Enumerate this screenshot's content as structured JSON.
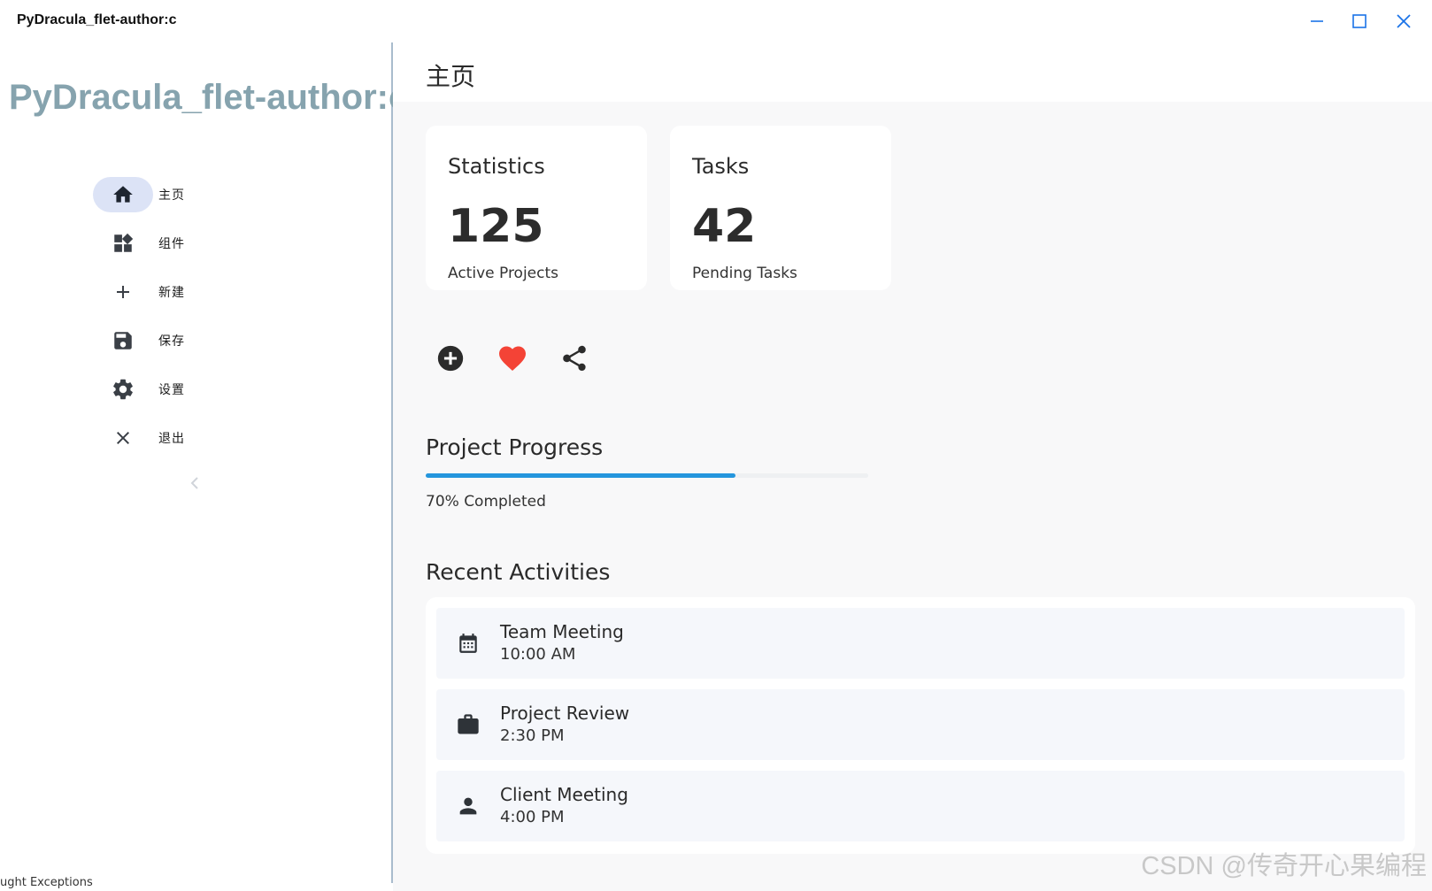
{
  "window": {
    "title": "PyDracula_flet-author:c"
  },
  "sidebar": {
    "brand": "PyDracula_flet-author:c",
    "items": [
      {
        "label": "主页",
        "icon": "home-icon",
        "active": true
      },
      {
        "label": "组件",
        "icon": "widgets-icon",
        "active": false
      },
      {
        "label": "新建",
        "icon": "add-icon",
        "active": false
      },
      {
        "label": "保存",
        "icon": "save-icon",
        "active": false
      },
      {
        "label": "设置",
        "icon": "settings-icon",
        "active": false
      },
      {
        "label": "退出",
        "icon": "close-icon",
        "active": false
      }
    ],
    "console_text": "ught Exceptions"
  },
  "main": {
    "page_title": "主页",
    "cards": [
      {
        "title": "Statistics",
        "value": "125",
        "subtitle": "Active Projects"
      },
      {
        "title": "Tasks",
        "value": "42",
        "subtitle": "Pending Tasks"
      }
    ],
    "actions": [
      {
        "icon": "add-circle-icon",
        "color": "#2b2b2b"
      },
      {
        "icon": "heart-icon",
        "color": "#f44336"
      },
      {
        "icon": "share-icon",
        "color": "#2b2b2b"
      }
    ],
    "progress": {
      "title": "Project Progress",
      "value": 0.7,
      "label": "70% Completed",
      "color": "#2496dd"
    },
    "activities": {
      "title": "Recent Activities",
      "items": [
        {
          "name": "Team Meeting",
          "time": "10:00 AM",
          "icon": "calendar-icon"
        },
        {
          "name": "Project Review",
          "time": "2:30 PM",
          "icon": "briefcase-icon"
        },
        {
          "name": "Client Meeting",
          "time": "4:00 PM",
          "icon": "person-icon"
        }
      ]
    }
  },
  "watermark": "CSDN @传奇开心果编程"
}
